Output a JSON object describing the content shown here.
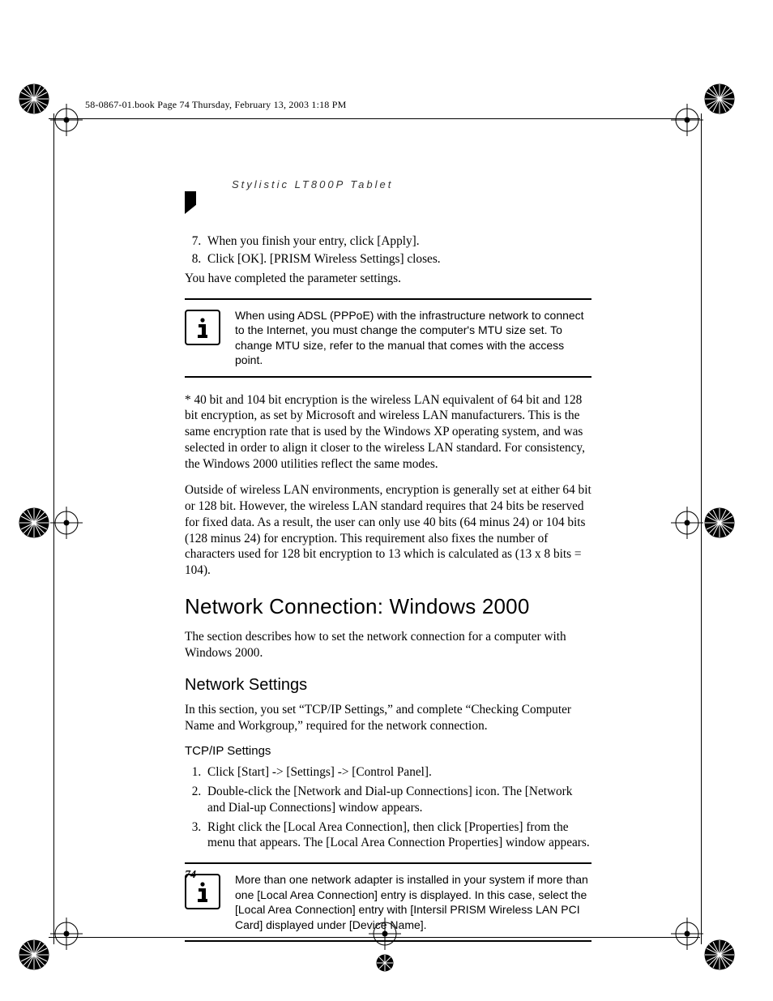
{
  "meta_line": "58-0867-01.book  Page 74  Thursday, February 13, 2003  1:18 PM",
  "running_head": "Stylistic LT800P Tablet",
  "resume_list": {
    "start": 7,
    "items": [
      "When you finish your entry, click [Apply].",
      "Click [OK]. [PRISM Wireless Settings] closes."
    ]
  },
  "after_list_line": "You have completed the parameter settings.",
  "note1": "When using ADSL (PPPoE) with the infrastructure network to connect to the Internet, you must change the computer's MTU size set. To change MTU size, refer to the manual that comes with the access point.",
  "footnote_para1": "* 40 bit and 104 bit encryption is the wireless LAN equivalent of 64 bit and 128 bit encryption, as set by Microsoft and wireless LAN manufacturers. This is the same encryption rate that is used by the Windows XP operating system, and was selected in order to align it closer to the wireless LAN standard. For consistency, the Windows 2000 utilities reflect the same modes.",
  "footnote_para2": "Outside of wireless LAN environments, encryption is generally set at either 64 bit or 128 bit. However, the wireless LAN standard requires that 24 bits be reserved for fixed data. As a result, the user can only use 40 bits (64 minus 24) or 104 bits (128 minus 24) for encryption. This requirement also fixes the number of characters used for 128 bit encryption to 13 which is calculated as (13 x 8 bits = 104).",
  "section_title": "Network Connection: Windows 2000",
  "section_intro": "The section describes how to set the network connection for a computer with Windows 2000.",
  "subsection_title": "Network Settings",
  "subsection_intro": "In this section, you set “TCP/IP Settings,” and complete “Checking Computer Name and Workgroup,” required for the network connection.",
  "subsub_title": "TCP/IP Settings",
  "steps": [
    "Click [Start] -> [Settings] -> [Control Panel].",
    "Double-click the [Network and Dial-up Connections] icon. The [Network and Dial-up Connections] window appears.",
    "Right click the [Local Area Connection], then click [Properties] from the menu that appears. The [Local Area Connection Properties] window appears."
  ],
  "note2": "More than one network adapter is installed in your system if more than one [Local Area Connection] entry is displayed. In this case, select the [Local Area Connection] entry with [Intersil PRISM Wireless LAN PCI Card] displayed under [Device Name].",
  "page_number": "74"
}
